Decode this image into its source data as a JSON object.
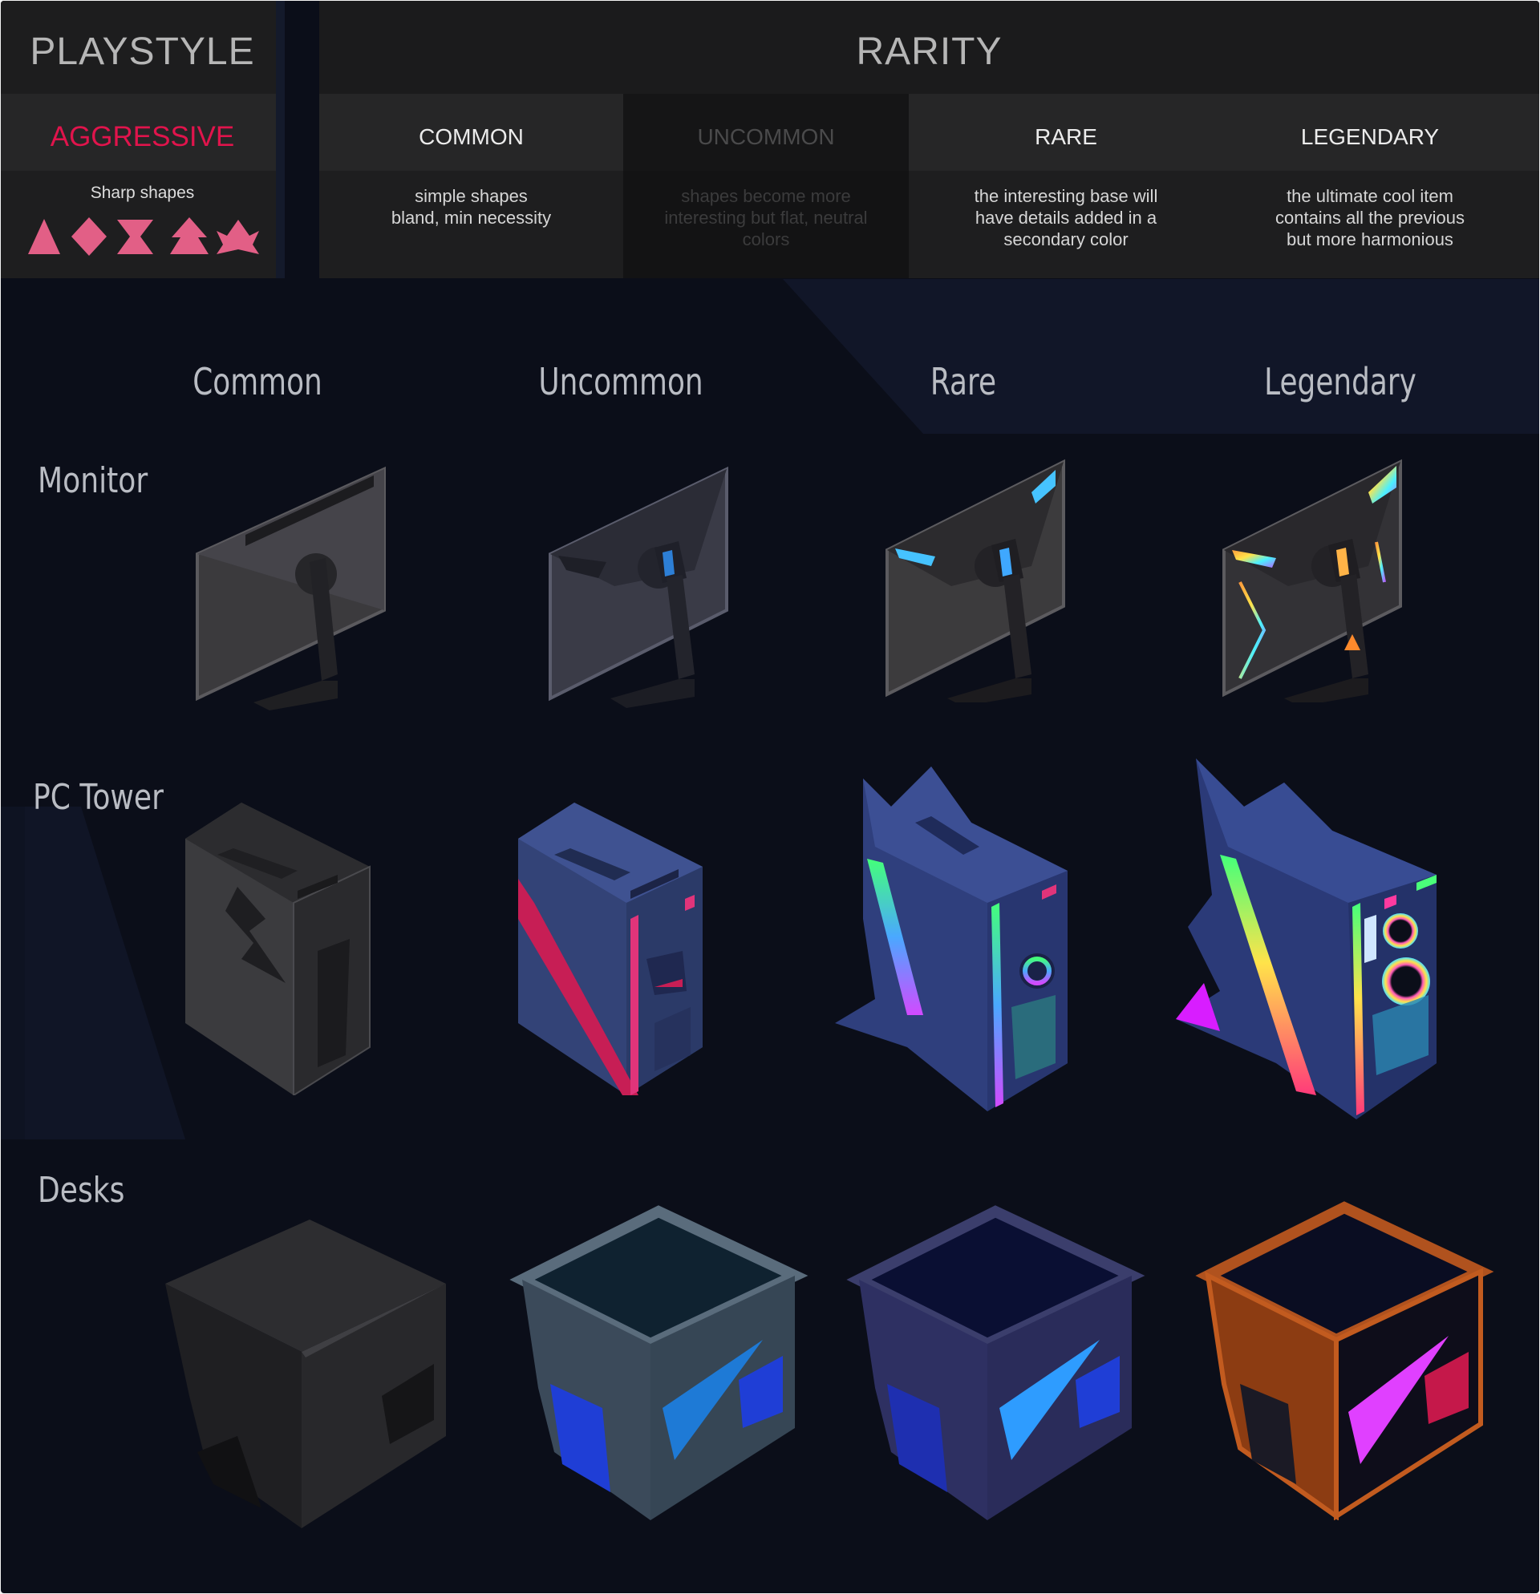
{
  "playstyle": {
    "header": "PLAYSTYLE",
    "type": "AGGRESSIVE",
    "shape_label": "Sharp shapes",
    "shape_icons": [
      "triangle-icon",
      "diamond-icon",
      "hourglass-icon",
      "arrow-up-icon",
      "star-icon"
    ],
    "accent_color": "#e0144c",
    "shape_color": "#e25f86"
  },
  "rarity": {
    "header": "RARITY",
    "columns": [
      {
        "label": "COMMON",
        "description": "simple shapes\nbland, min necessity",
        "dimmed": false
      },
      {
        "label": "UNCOMMON",
        "description": "shapes become more\ninteresting but flat, neutral\ncolors",
        "dimmed": true
      },
      {
        "label": "RARE",
        "description": "the interesting base will\nhave details added in a\nsecondary color",
        "dimmed": false
      },
      {
        "label": "LEGENDARY",
        "description": "the ultimate cool item\ncontains all the previous\nbut more harmonious",
        "dimmed": false
      }
    ]
  },
  "grid": {
    "columns": [
      "Common",
      "Uncommon",
      "Rare",
      "Legendary"
    ],
    "rows": [
      {
        "label": "Monitor",
        "items": [
          "monitor-common",
          "monitor-uncommon",
          "monitor-rare",
          "monitor-legendary"
        ]
      },
      {
        "label": "PC Tower",
        "items": [
          "tower-common",
          "tower-uncommon",
          "tower-rare",
          "tower-legendary"
        ]
      },
      {
        "label": "Desks",
        "items": [
          "desk-common",
          "desk-uncommon",
          "desk-rare",
          "desk-legendary"
        ]
      }
    ]
  }
}
